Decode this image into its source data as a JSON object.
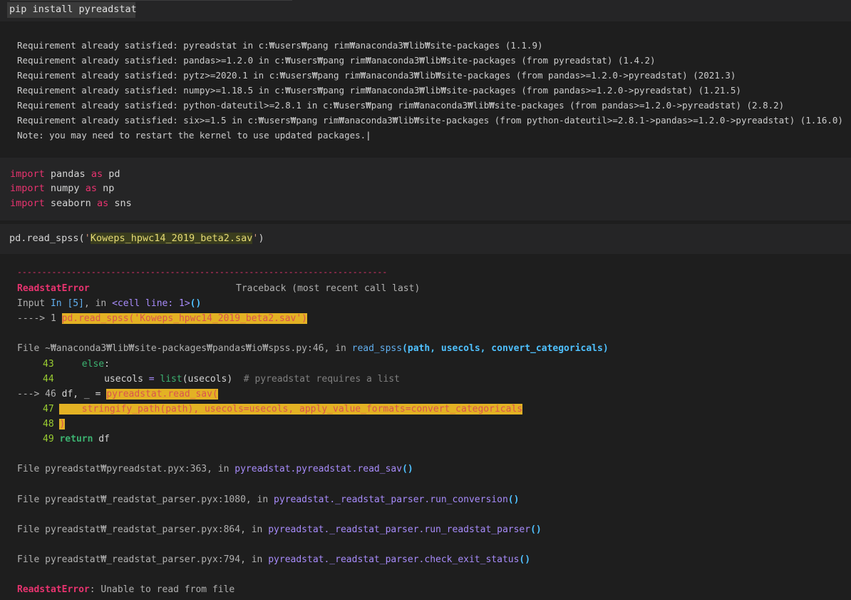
{
  "cell1": {
    "command": "pip install pyreadstat",
    "output": [
      "Requirement already satisfied: pyreadstat in c:₩users₩pang rim₩anaconda3₩lib₩site-packages (1.1.9)",
      "Requirement already satisfied: pandas>=1.2.0 in c:₩users₩pang rim₩anaconda3₩lib₩site-packages (from pyreadstat) (1.4.2)",
      "Requirement already satisfied: pytz>=2020.1 in c:₩users₩pang rim₩anaconda3₩lib₩site-packages (from pandas>=1.2.0->pyreadstat) (2021.3)",
      "Requirement already satisfied: numpy>=1.18.5 in c:₩users₩pang rim₩anaconda3₩lib₩site-packages (from pandas>=1.2.0->pyreadstat) (1.21.5)",
      "Requirement already satisfied: python-dateutil>=2.8.1 in c:₩users₩pang rim₩anaconda3₩lib₩site-packages (from pandas>=1.2.0->pyreadstat) (2.8.2)",
      "Requirement already satisfied: six>=1.5 in c:₩users₩pang rim₩anaconda3₩lib₩site-packages (from python-dateutil>=2.8.1->pandas>=1.2.0->pyreadstat) (1.16.0)",
      "Note: you may need to restart the kernel to use updated packages."
    ]
  },
  "cell2": {
    "lines": [
      {
        "kw": "import",
        "mod": " pandas ",
        "as": "as",
        "alias": " pd"
      },
      {
        "kw": "import",
        "mod": " numpy ",
        "as": "as",
        "alias": " np"
      },
      {
        "kw": "import",
        "mod": " seaborn ",
        "as": "as",
        "alias": " sns"
      }
    ]
  },
  "cell3": {
    "prefix": "pd.read_spss(",
    "quote_open": "'",
    "filename": "Koweps_hpwc14_2019_beta2.sav",
    "quote_close": "'",
    "suffix": ")"
  },
  "traceback": {
    "separator": "---------------------------------------------------------------------------",
    "error_name": "ReadstatError",
    "header_right": "Traceback (most recent call last)",
    "input_prefix": "Input ",
    "input_in": "In [5]",
    "input_mid": ", in ",
    "input_cell": "<cell line: 1>",
    "input_parens": "()",
    "arrow1": "----> 1 ",
    "arrow1_code": "pd.read_spss('Koweps_hpwc14_2019_beta2.sav')",
    "file1_prefix": "File ",
    "file1_path": "~₩anaconda3₩lib₩site-packages₩pandas₩io₩spss.py:46",
    "file1_mid": ", in ",
    "file1_func": "read_spss",
    "file1_args": "(path, usecols, convert_categoricals)",
    "l43_num": "43",
    "l43_code": "else",
    "l43_colon": ":",
    "l44_num": "44",
    "l44_code_a": "usecols ",
    "l44_eq": "=",
    "l44_list": " list",
    "l44_rest": "(usecols)  ",
    "l44_cmt": "# pyreadstat requires a list",
    "l46_arrow": "---> 46 ",
    "l46_code": "df, _ = ",
    "l46_hl": "pyreadstat.read_sav(",
    "l47_num": "47",
    "l47_hl": "    stringify_path(path), usecols=usecols, apply_value_formats=convert_categoricals",
    "l48_num": "48",
    "l48_hl": ")",
    "l49_num": "49",
    "l49_kw": "return",
    "l49_rest": " df",
    "frames": [
      {
        "path": "pyreadstat₩pyreadstat.pyx:363",
        "func": "pyreadstat.pyreadstat.read_sav"
      },
      {
        "path": "pyreadstat₩_readstat_parser.pyx:1080",
        "func": "pyreadstat._readstat_parser.run_conversion"
      },
      {
        "path": "pyreadstat₩_readstat_parser.pyx:864",
        "func": "pyreadstat._readstat_parser.run_readstat_parser"
      },
      {
        "path": "pyreadstat₩_readstat_parser.pyx:794",
        "func": "pyreadstat._readstat_parser.check_exit_status"
      }
    ],
    "frame_prefix": "File ",
    "frame_mid": ", in ",
    "frame_parens": "()",
    "final_error": "ReadstatError",
    "final_msg": ": Unable to read from file"
  }
}
